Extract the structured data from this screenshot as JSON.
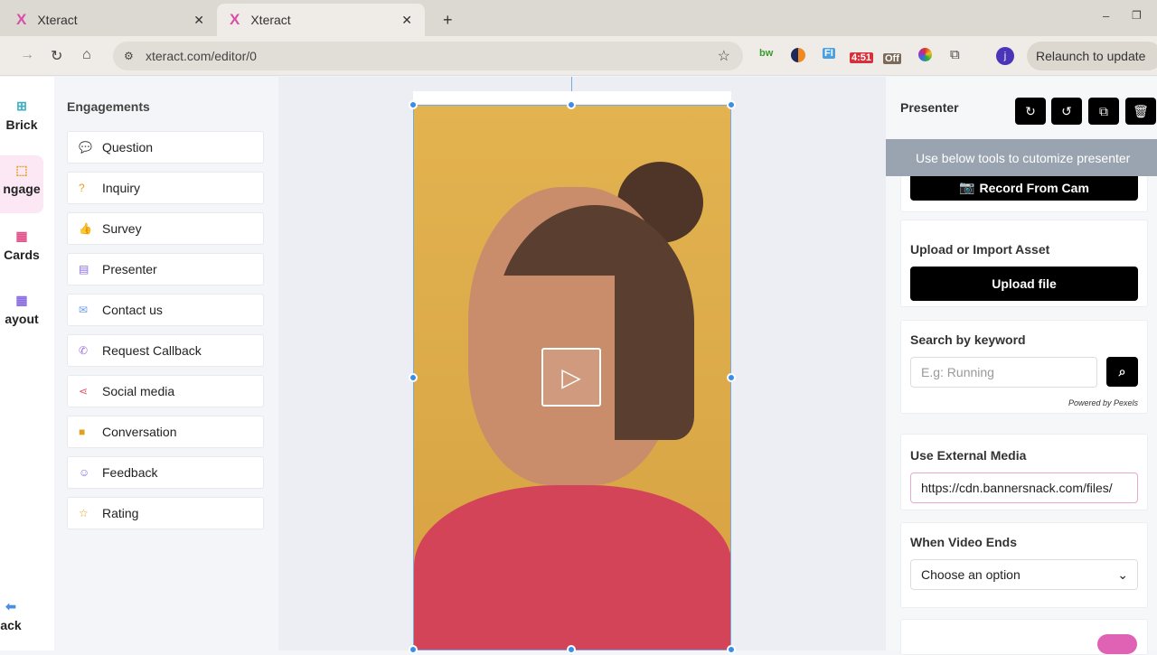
{
  "browser": {
    "tabs": [
      {
        "title": "Xteract",
        "favicon": "X"
      },
      {
        "title": "Xteract",
        "favicon": "X"
      }
    ],
    "url": "xteract.com/editor/0",
    "relaunch": "Relaunch to update",
    "extensions": [
      "bw",
      "4:51",
      "Off",
      "FI"
    ],
    "profile": "j"
  },
  "rail": [
    {
      "label": "Brick"
    },
    {
      "label": "ngage"
    },
    {
      "label": "Cards"
    },
    {
      "label": "ayout"
    },
    {
      "label": "ack"
    }
  ],
  "engagements": {
    "title": "Engagements",
    "items": [
      {
        "label": "Question",
        "icon": "chat",
        "color": "#6b9ee8"
      },
      {
        "label": "Inquiry",
        "icon": "help",
        "color": "#e0a020"
      },
      {
        "label": "Survey",
        "icon": "thumbs-up",
        "color": "#e06b9e"
      },
      {
        "label": "Presenter",
        "icon": "film",
        "color": "#8b6be0"
      },
      {
        "label": "Contact us",
        "icon": "mail",
        "color": "#6b9ee8"
      },
      {
        "label": "Request Callback",
        "icon": "phone",
        "color": "#a06be0"
      },
      {
        "label": "Social media",
        "icon": "share",
        "color": "#e05b6b"
      },
      {
        "label": "Conversation",
        "icon": "video",
        "color": "#e0a020"
      },
      {
        "label": "Feedback",
        "icon": "smile",
        "color": "#8b6be0"
      },
      {
        "label": "Rating",
        "icon": "star",
        "color": "#e0a020"
      }
    ]
  },
  "presenter": {
    "title": "Presenter",
    "tooltip": "Use below tools to cutomize presenter",
    "record": "Record From Cam",
    "upload_label": "Upload or Import Asset",
    "upload_button": "Upload file",
    "search_label": "Search by keyword",
    "search_placeholder": "E.g: Running",
    "powered": "Powered by Pexels",
    "external_label": "Use External Media",
    "external_value": "https://cdn.bannersnack.com/files/",
    "video_ends_label": "When Video Ends",
    "video_ends_value": "Choose an option"
  }
}
